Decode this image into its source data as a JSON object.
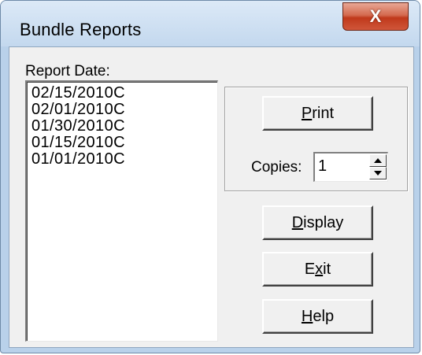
{
  "window": {
    "title": "Bundle Reports",
    "close_glyph": "X"
  },
  "report_date": {
    "label": "Report Date:",
    "items": [
      "02/15/2010C",
      "02/01/2010C",
      "01/30/2010C",
      "01/15/2010C",
      "01/01/2010C"
    ]
  },
  "print_group": {
    "print_button": {
      "mnemonic": "P",
      "rest": "rint"
    },
    "copies_label": "Copies:",
    "copies_value": "1"
  },
  "buttons": {
    "display": {
      "mnemonic": "D",
      "rest": "isplay"
    },
    "exit": {
      "pre": "E",
      "mnemonic": "x",
      "rest": "it"
    },
    "help": {
      "mnemonic": "H",
      "rest": "elp"
    }
  },
  "icons": {
    "close": "close-icon",
    "spin_up": "arrow-up-icon",
    "spin_down": "arrow-down-icon"
  }
}
